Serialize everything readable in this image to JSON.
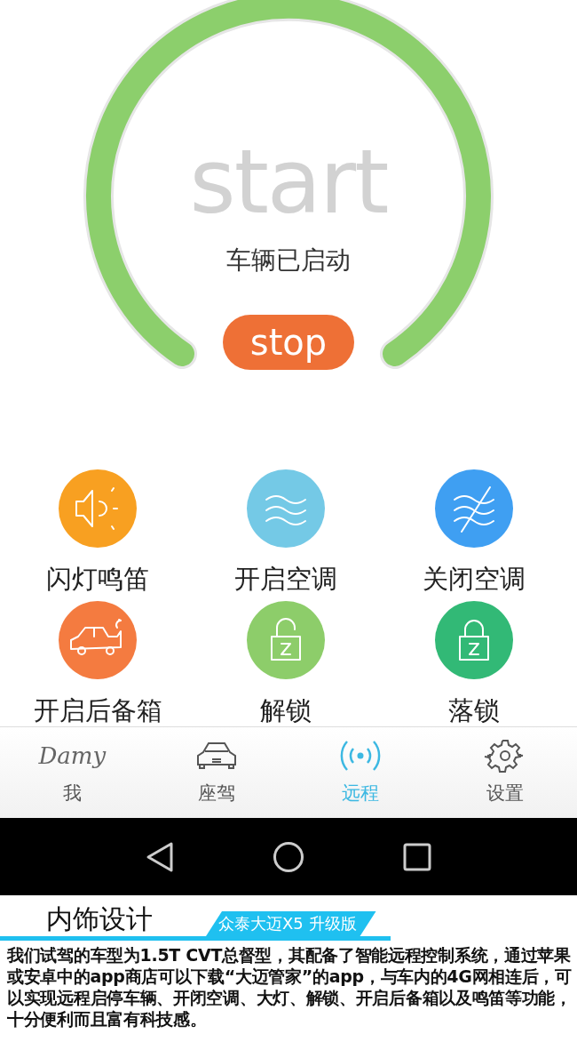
{
  "gauge": {
    "title": "start",
    "status": "车辆已启动"
  },
  "stop_button": {
    "label": "stop"
  },
  "actions": [
    {
      "label": "闪灯鸣笛",
      "kind": "horn",
      "color": "#f8a021"
    },
    {
      "label": "开启空调",
      "kind": "ac_on",
      "color": "#74c9e6"
    },
    {
      "label": "关闭空调",
      "kind": "ac_off",
      "color": "#3f9ff2"
    },
    {
      "label": "开启后备箱",
      "kind": "trunk",
      "color": "#f47b40"
    },
    {
      "label": "解锁",
      "kind": "unlock",
      "color": "#8dcd6a"
    },
    {
      "label": "落锁",
      "kind": "lock",
      "color": "#32b976"
    }
  ],
  "tabs": [
    {
      "label": "我",
      "kind": "logo",
      "logo": "Damy",
      "selected": false
    },
    {
      "label": "座驾",
      "kind": "car",
      "selected": false
    },
    {
      "label": "远程",
      "kind": "signal",
      "selected": true
    },
    {
      "label": "设置",
      "kind": "gear",
      "selected": false
    }
  ],
  "caption": {
    "heading": "内饰设计",
    "tag": "众泰大迈X5 升级版",
    "paragraph": "我们试驾的车型为1.5T CVT总督型，其配备了智能远程控制系统，通过苹果或安卓中的app商店可以下载“大迈管家”的app，与车内的4G网相连后，可以实现远程启停车辆、开闭空调、大灯、解锁、开启后备箱以及鸣笛等功能，十分便利而且富有科技感。"
  }
}
